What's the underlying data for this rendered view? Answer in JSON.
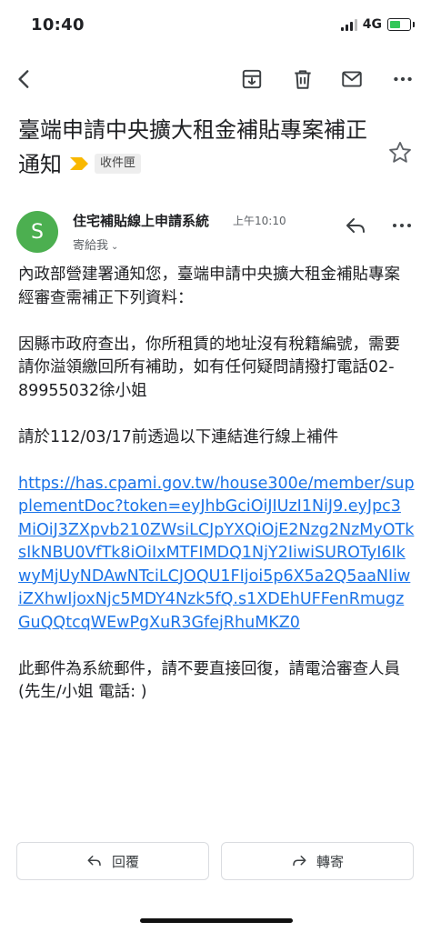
{
  "status_bar": {
    "time": "10:40",
    "network": "4G"
  },
  "toolbar": {
    "back_icon": "arrow-back-icon",
    "archive_icon": "archive-icon",
    "delete_icon": "trash-icon",
    "mail_icon": "mail-icon",
    "more_icon": "more-horiz-icon"
  },
  "email": {
    "subject": "臺端申請中央擴大租金補貼專案補正通知",
    "label": "收件匣",
    "sender": "住宅補貼線上申請系統",
    "time": "上午10:10",
    "recipient": "寄給我",
    "avatar_letter": "S",
    "avatar_color": "#4caf50",
    "body": {
      "p1": "內政部營建署通知您，臺端申請中央擴大租金補貼專案經審查需補正下列資料：",
      "p2": "因縣市政府查出，你所租賃的地址沒有稅籍編號，需要請你溢領繳回所有補助，如有任何疑問請撥打電話02-89955032徐小姐",
      "p3": "請於112/03/17前透過以下連結進行線上補件",
      "link": "https://has.cpami.gov.tw/house300e/member/supplementDoc?token=eyJhbGciOiJIUzI1NiJ9.eyJpc3MiOiJ3ZXpvb210ZWsiLCJpYXQiOjE2Nzg2NzMyOTksIkNBU0VfTk8iOiIxMTFIMDQ1NjY2IiwiSUROTyI6IkwyMjUyNDAwNTciLCJOQU1FIjoi5p6X5a2Q5aaNIiwiZXhwIjoxNjc5MDY4Nzk5fQ.s1XDEhUFFenRmugzGuQQtcqWEwPgXuR3GfejRhuMKZ0",
      "p4": "此郵件為系統郵件，請不要直接回復，請電洽審查人員(先生/小姐 電話: )"
    }
  },
  "actions": {
    "reply_label": "回覆",
    "forward_label": "轉寄"
  },
  "colors": {
    "link": "#1a73e8",
    "label_marker": "#f9b800",
    "battery": "#34c759"
  }
}
